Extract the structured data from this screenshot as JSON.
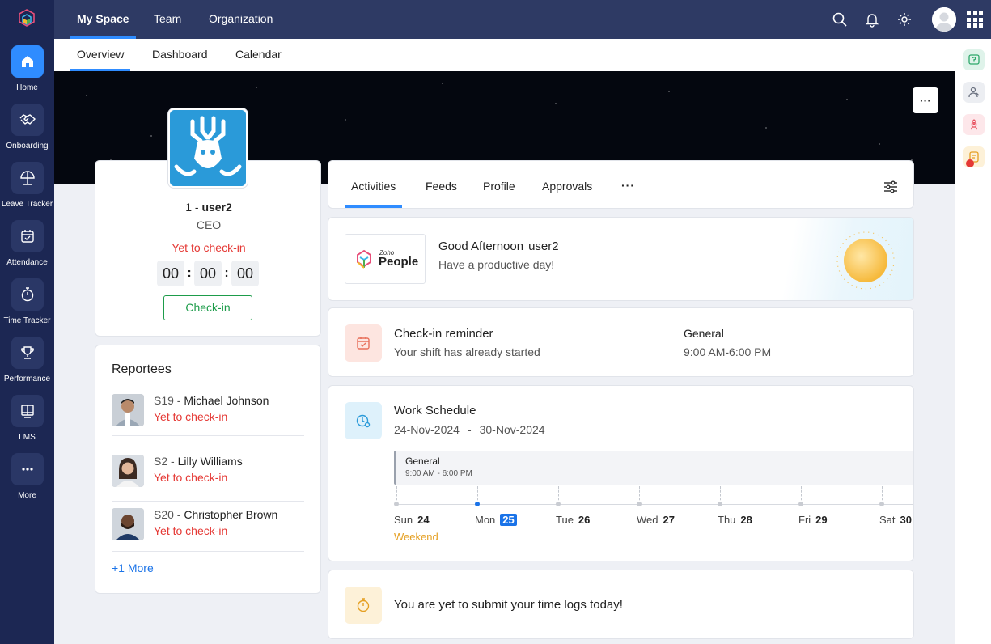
{
  "sidebar": {
    "items": [
      {
        "label": "Home",
        "icon": "home-icon",
        "active": true
      },
      {
        "label": "Onboarding",
        "icon": "handshake-icon"
      },
      {
        "label": "Leave Tracker",
        "icon": "umbrella-icon"
      },
      {
        "label": "Attendance",
        "icon": "calendar-check-icon"
      },
      {
        "label": "Time Tracker",
        "icon": "stopwatch-icon"
      },
      {
        "label": "Performance",
        "icon": "trophy-icon"
      },
      {
        "label": "LMS",
        "icon": "book-icon"
      },
      {
        "label": "More",
        "icon": "more-icon"
      }
    ]
  },
  "header": {
    "tabs": [
      {
        "label": "My Space",
        "active": true
      },
      {
        "label": "Team"
      },
      {
        "label": "Organization"
      }
    ],
    "icons": [
      "search-icon",
      "bell-icon",
      "gear-icon",
      "avatar",
      "app-grid-icon"
    ]
  },
  "subnav": {
    "tabs": [
      {
        "label": "Overview",
        "active": true
      },
      {
        "label": "Dashboard"
      },
      {
        "label": "Calendar"
      }
    ]
  },
  "banner": {
    "more_label": "···"
  },
  "profile": {
    "id": "1 -",
    "name": "user2",
    "title": "CEO",
    "status": "Yet to check-in",
    "timer": {
      "h": "00",
      "m": "00",
      "s": "00",
      "sep": ":"
    },
    "checkin_label": "Check-in"
  },
  "reportees": {
    "title": "Reportees",
    "items": [
      {
        "id": "S19 -",
        "name": "Michael Johnson",
        "status": "Yet to check-in"
      },
      {
        "id": "S2 -",
        "name": "Lilly Williams",
        "status": "Yet to check-in"
      },
      {
        "id": "S20 -",
        "name": "Christopher Brown",
        "status": "Yet to check-in"
      }
    ],
    "more_label": "+1 More"
  },
  "content_tabs": {
    "items": [
      {
        "label": "Activities",
        "active": true
      },
      {
        "label": "Feeds"
      },
      {
        "label": "Profile"
      },
      {
        "label": "Approvals"
      }
    ],
    "more_label": "···"
  },
  "greeting": {
    "logo_zoho": "Zoho",
    "logo_people": "People",
    "title": "Good Afternoon",
    "user": "user2",
    "subtitle": "Have a productive day!"
  },
  "reminder": {
    "title": "Check-in reminder",
    "subtitle": "Your shift has already started",
    "shift_name": "General",
    "shift_time": "9:00 AM-6:00 PM"
  },
  "schedule": {
    "title": "Work Schedule",
    "range_start": "24-Nov-2024",
    "range_sep": "-",
    "range_end": "30-Nov-2024",
    "shift_name": "General",
    "shift_time": "9:00 AM - 6:00 PM",
    "days": [
      {
        "name": "Sun",
        "num": "24"
      },
      {
        "name": "Mon",
        "num": "25",
        "today": true
      },
      {
        "name": "Tue",
        "num": "26"
      },
      {
        "name": "Wed",
        "num": "27"
      },
      {
        "name": "Thu",
        "num": "28"
      },
      {
        "name": "Fri",
        "num": "29"
      },
      {
        "name": "Sat",
        "num": "30"
      }
    ],
    "weekend_label": "Weekend"
  },
  "timelog": {
    "text": "You are yet to submit your time logs today!"
  },
  "colors": {
    "sidebar": "#1c2753",
    "header": "#2e3a64",
    "accent": "#2f8cff",
    "danger": "#e53935",
    "success": "#1d9c4a",
    "warning": "#e5a023"
  }
}
